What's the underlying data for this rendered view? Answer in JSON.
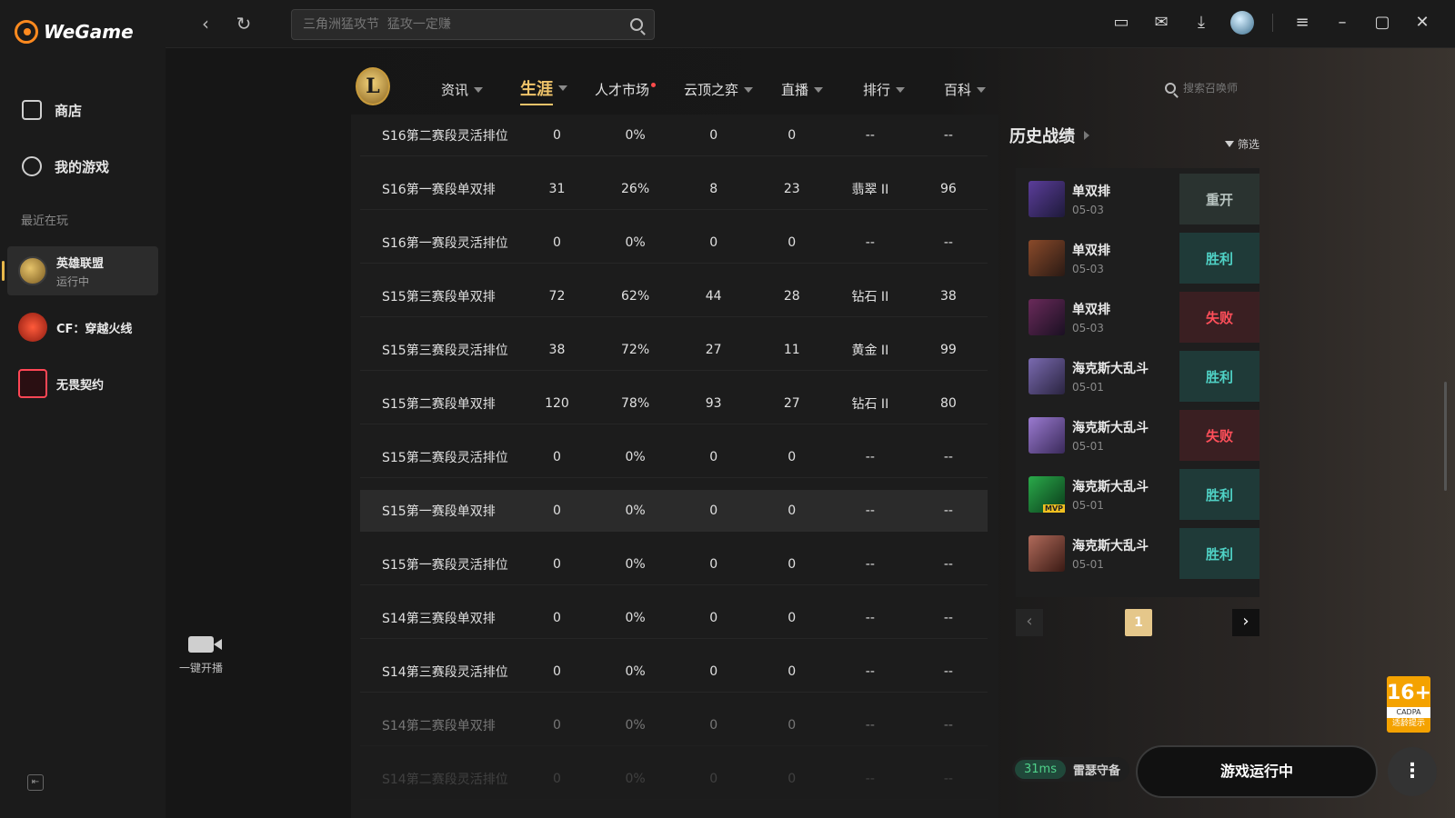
{
  "app": {
    "logo_text": "WeGame"
  },
  "sidebar": {
    "nav": [
      {
        "label": "商店",
        "icon": "bag-icon"
      },
      {
        "label": "我的游戏",
        "icon": "gamepad-icon"
      }
    ],
    "recent_label": "最近在玩",
    "recent": [
      {
        "name": "英雄联盟",
        "status": "运行中",
        "icon": "lol-icon"
      },
      {
        "name": "CF：穿越火线",
        "status": "",
        "icon": "cf-icon"
      },
      {
        "name": "无畏契约",
        "status": "",
        "icon": "valorant-icon"
      }
    ],
    "stream_label": "一键开播",
    "collapse_icon": "collapse-icon"
  },
  "topbar": {
    "search_placeholder": "三角洲猛攻节  猛攻一定赚",
    "icons": [
      "chat-icon",
      "mail-icon",
      "download-icon",
      "avatar",
      "menu-icon",
      "minimize-icon",
      "maximize-icon",
      "close-icon"
    ]
  },
  "game_nav": {
    "logo_letter": "L",
    "tabs": [
      {
        "label": "资讯",
        "caret": true
      },
      {
        "label": "生涯",
        "caret": true,
        "active": true
      },
      {
        "label": "人才市场",
        "caret": false,
        "dot": true
      },
      {
        "label": "云顶之弈",
        "caret": true
      },
      {
        "label": "直播",
        "caret": true
      },
      {
        "label": "排行",
        "caret": true
      },
      {
        "label": "百科",
        "caret": true
      }
    ],
    "summoner_search_placeholder": "搜索召唤师"
  },
  "season_table": {
    "rows": [
      [
        "S16第二赛段灵活排位",
        "0",
        "0%",
        "0",
        "0",
        "--",
        "--"
      ],
      [
        "S16第一赛段单双排",
        "31",
        "26%",
        "8",
        "23",
        "翡翠 II",
        "96"
      ],
      [
        "S16第一赛段灵活排位",
        "0",
        "0%",
        "0",
        "0",
        "--",
        "--"
      ],
      [
        "S15第三赛段单双排",
        "72",
        "62%",
        "44",
        "28",
        "钻石 II",
        "38"
      ],
      [
        "S15第三赛段灵活排位",
        "38",
        "72%",
        "27",
        "11",
        "黄金 II",
        "99"
      ],
      [
        "S15第二赛段单双排",
        "120",
        "78%",
        "93",
        "27",
        "钻石 II",
        "80"
      ],
      [
        "S15第二赛段灵活排位",
        "0",
        "0%",
        "0",
        "0",
        "--",
        "--"
      ],
      [
        "S15第一赛段单双排",
        "0",
        "0%",
        "0",
        "0",
        "--",
        "--"
      ],
      [
        "S15第一赛段灵活排位",
        "0",
        "0%",
        "0",
        "0",
        "--",
        "--"
      ],
      [
        "S14第三赛段单双排",
        "0",
        "0%",
        "0",
        "0",
        "--",
        "--"
      ],
      [
        "S14第三赛段灵活排位",
        "0",
        "0%",
        "0",
        "0",
        "--",
        "--"
      ],
      [
        "S14第二赛段单双排",
        "0",
        "0%",
        "0",
        "0",
        "--",
        "--"
      ],
      [
        "S14第二赛段灵活排位",
        "0",
        "0%",
        "0",
        "0",
        "--",
        "--"
      ]
    ],
    "highlighted_row": 7
  },
  "history": {
    "title": "历史战绩",
    "filter_label": "筛选",
    "matches": [
      {
        "mode": "单双排",
        "date": "05-03",
        "result": "重开",
        "type": "remake"
      },
      {
        "mode": "单双排",
        "date": "05-03",
        "result": "胜利",
        "type": "win"
      },
      {
        "mode": "单双排",
        "date": "05-03",
        "result": "失败",
        "type": "lose"
      },
      {
        "mode": "海克斯大乱斗",
        "date": "05-01",
        "result": "胜利",
        "type": "win"
      },
      {
        "mode": "海克斯大乱斗",
        "date": "05-01",
        "result": "失败",
        "type": "lose"
      },
      {
        "mode": "海克斯大乱斗",
        "date": "05-01",
        "result": "胜利",
        "type": "win"
      },
      {
        "mode": "海克斯大乱斗",
        "date": "05-01",
        "result": "胜利",
        "type": "win"
      }
    ],
    "page": "1"
  },
  "footer": {
    "ping": "31ms",
    "server": "雷瑟守备",
    "play_label": "游戏运行中",
    "age_rating": "16+",
    "age_sub": "CADPA",
    "age_tip": "适龄提示"
  }
}
